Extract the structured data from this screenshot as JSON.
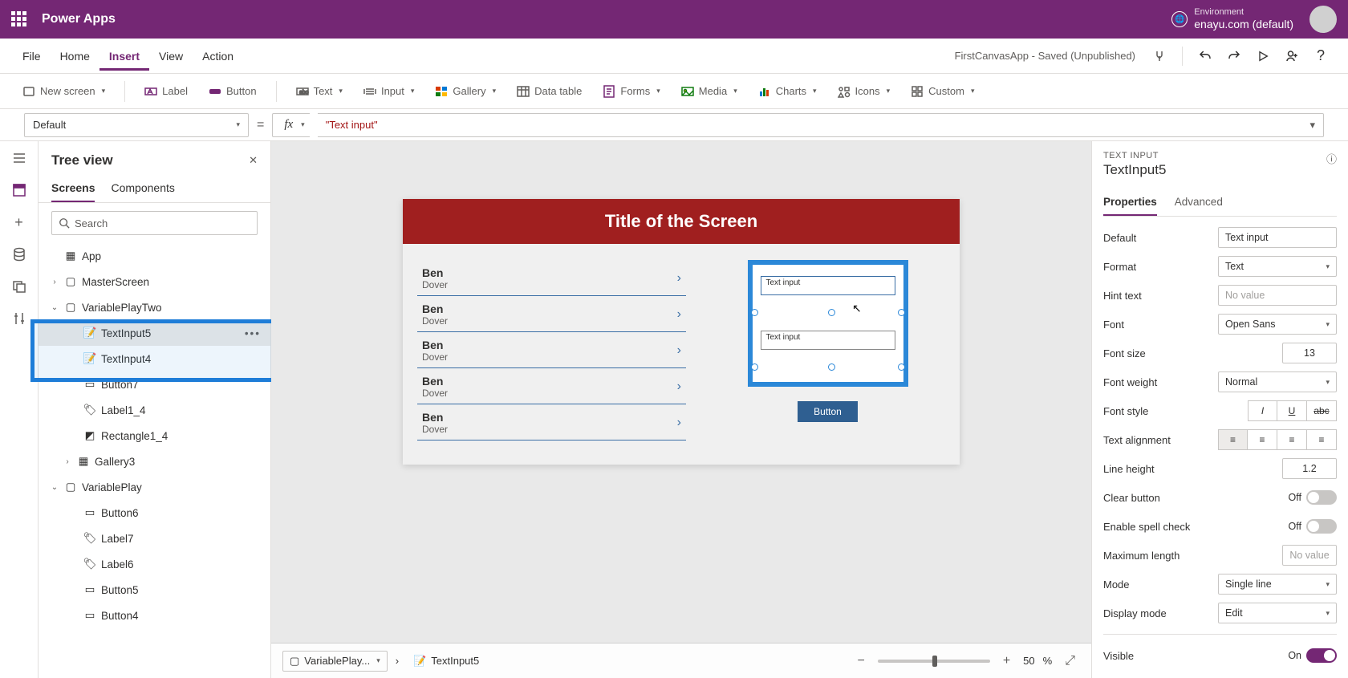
{
  "brand": {
    "app_name": "Power Apps",
    "env_label": "Environment",
    "env_name": "enayu.com (default)"
  },
  "menu": {
    "file": "File",
    "home": "Home",
    "insert": "Insert",
    "view": "View",
    "action": "Action",
    "saved": "FirstCanvasApp - Saved (Unpublished)"
  },
  "ribbon": {
    "new_screen": "New screen",
    "label": "Label",
    "button": "Button",
    "text": "Text",
    "input": "Input",
    "gallery": "Gallery",
    "data_table": "Data table",
    "forms": "Forms",
    "media": "Media",
    "charts": "Charts",
    "icons": "Icons",
    "custom": "Custom"
  },
  "formula": {
    "property": "Default",
    "value": "\"Text input\""
  },
  "tree": {
    "title": "Tree view",
    "tabs": {
      "screens": "Screens",
      "components": "Components"
    },
    "search_ph": "Search",
    "nodes": {
      "app": "App",
      "master": "MasterScreen",
      "vpt": "VariablePlayTwo",
      "ti5": "TextInput5",
      "ti4": "TextInput4",
      "btn7": "Button7",
      "lbl14": "Label1_4",
      "rect14": "Rectangle1_4",
      "gal3": "Gallery3",
      "vp": "VariablePlay",
      "btn6": "Button6",
      "lbl7": "Label7",
      "lbl6": "Label6",
      "btn5": "Button5",
      "btn4": "Button4"
    }
  },
  "canvas": {
    "title": "Title of the Screen",
    "rows": [
      {
        "name": "Ben",
        "sub": "Dover"
      },
      {
        "name": "Ben",
        "sub": "Dover"
      },
      {
        "name": "Ben",
        "sub": "Dover"
      },
      {
        "name": "Ben",
        "sub": "Dover"
      },
      {
        "name": "Ben",
        "sub": "Dover"
      }
    ],
    "input1": "Text input",
    "input2": "Text input",
    "button": "Button"
  },
  "footer": {
    "crumb1": "VariablePlay...",
    "crumb2": "TextInput5",
    "zoom": "50",
    "zoom_pct": "%"
  },
  "props": {
    "type": "TEXT INPUT",
    "name": "TextInput5",
    "tabs": {
      "properties": "Properties",
      "advanced": "Advanced"
    },
    "rows": {
      "default_l": "Default",
      "default_v": "Text input",
      "format_l": "Format",
      "format_v": "Text",
      "hint_l": "Hint text",
      "hint_v": "No value",
      "font_l": "Font",
      "font_v": "Open Sans",
      "size_l": "Font size",
      "size_v": "13",
      "weight_l": "Font weight",
      "weight_v": "Normal",
      "style_l": "Font style",
      "align_l": "Text alignment",
      "lh_l": "Line height",
      "lh_v": "1.2",
      "clear_l": "Clear button",
      "clear_v": "Off",
      "spell_l": "Enable spell check",
      "spell_v": "Off",
      "max_l": "Maximum length",
      "max_v": "No value",
      "mode_l": "Mode",
      "mode_v": "Single line",
      "disp_l": "Display mode",
      "disp_v": "Edit",
      "vis_l": "Visible",
      "vis_v": "On"
    }
  }
}
